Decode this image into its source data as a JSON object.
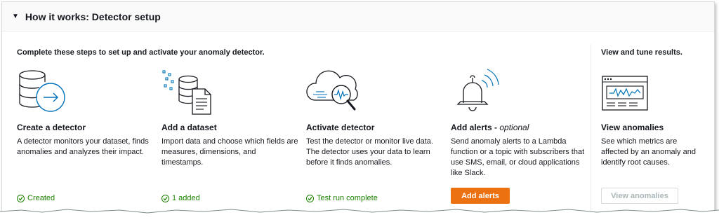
{
  "header": {
    "title": "How it works: Detector setup"
  },
  "intro": "Complete these steps to set up and activate your anomaly detector.",
  "side_title": "View and tune results.",
  "steps": [
    {
      "title": "Create a detector",
      "title_suffix": "",
      "icon": "database-arrow-icon",
      "description": "A detector monitors your dataset, finds anomalies and analyzes their impact.",
      "status": "Created"
    },
    {
      "title": "Add a dataset",
      "title_suffix": "",
      "icon": "dataset-document-icon",
      "description": "Import data and choose which fields are measures, dimensions, and timestamps.",
      "status": "1 added"
    },
    {
      "title": "Activate detector",
      "title_suffix": "",
      "icon": "cloud-magnifier-icon",
      "description": "Test the detector or monitor live data. The detector uses your data to learn before it finds anomalies.",
      "status": "Test run complete"
    },
    {
      "title": "Add alerts - ",
      "title_suffix": "optional",
      "icon": "bell-alert-icon",
      "description": "Send anomaly alerts to a Lambda function or a topic with subscribers that use SMS, email, or cloud applications like Slack.",
      "button": "Add alerts"
    },
    {
      "title": "View anomalies",
      "title_suffix": "",
      "icon": "monitor-chart-icon",
      "description": "See which metrics are affected by an anomaly and identify root causes.",
      "button": "View anomalies"
    }
  ],
  "colors": {
    "accent": "#ec7211",
    "success": "#1d8102",
    "disabled": "#aab7b8",
    "border": "#d5dbdb"
  }
}
